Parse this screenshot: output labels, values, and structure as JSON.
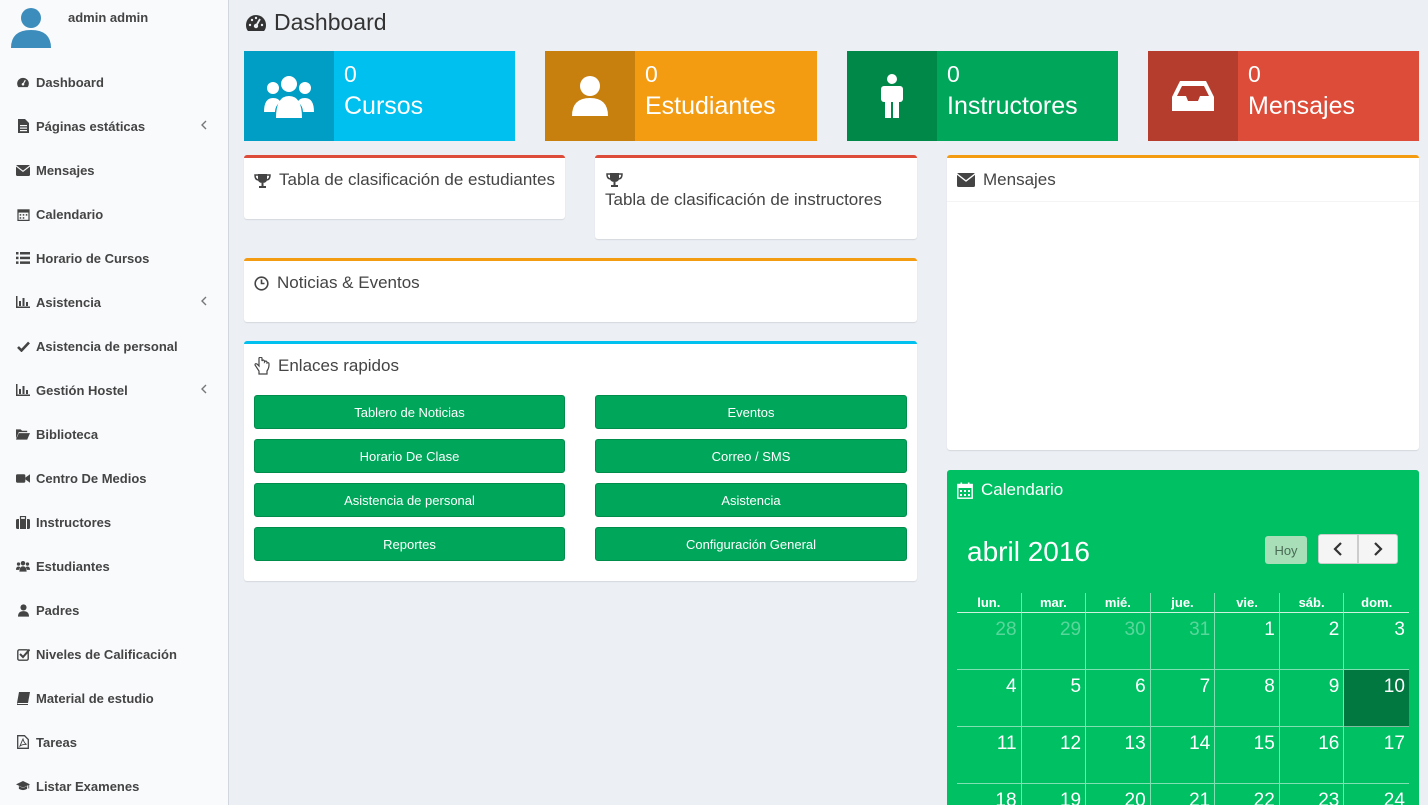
{
  "user": {
    "name": "admin admin"
  },
  "sidebar": {
    "items": [
      {
        "label": "Dashboard",
        "icon": "dashboard-icon",
        "submenu": false
      },
      {
        "label": "Páginas estáticas",
        "icon": "file-icon",
        "submenu": true
      },
      {
        "label": "Mensajes",
        "icon": "envelope-icon",
        "submenu": false
      },
      {
        "label": "Calendario",
        "icon": "calendar-icon",
        "submenu": false
      },
      {
        "label": "Horario de Cursos",
        "icon": "list-icon",
        "submenu": false
      },
      {
        "label": "Asistencia",
        "icon": "bar-chart-icon",
        "submenu": true
      },
      {
        "label": "Asistencia de personal",
        "icon": "check-icon",
        "submenu": false
      },
      {
        "label": "Gestión Hostel",
        "icon": "bar-chart-icon",
        "submenu": true
      },
      {
        "label": "Biblioteca",
        "icon": "folder-open-icon",
        "submenu": false
      },
      {
        "label": "Centro De Medios",
        "icon": "video-camera-icon",
        "submenu": false
      },
      {
        "label": "Instructores",
        "icon": "briefcase-icon",
        "submenu": false
      },
      {
        "label": "Estudiantes",
        "icon": "users-icon",
        "submenu": false
      },
      {
        "label": "Padres",
        "icon": "user-icon",
        "submenu": false
      },
      {
        "label": "Niveles de Calificación",
        "icon": "check-square-icon",
        "submenu": false
      },
      {
        "label": "Material de estudio",
        "icon": "book-icon",
        "submenu": false
      },
      {
        "label": "Tareas",
        "icon": "file-pdf-icon",
        "submenu": false
      },
      {
        "label": "Listar Examenes",
        "icon": "graduation-cap-icon",
        "submenu": false
      }
    ]
  },
  "header": {
    "title": "Dashboard"
  },
  "info_boxes": [
    {
      "number": "0",
      "label": "Cursos",
      "color": "#00c0ef",
      "icon": "users-icon"
    },
    {
      "number": "0",
      "label": "Estudiantes",
      "color": "#f39c12",
      "icon": "user-icon"
    },
    {
      "number": "0",
      "label": "Instructores",
      "color": "#00a65a",
      "icon": "male-icon"
    },
    {
      "number": "0",
      "label": "Mensajes",
      "color": "#dd4b39",
      "icon": "inbox-icon"
    }
  ],
  "boxes": {
    "students_leaderboard": "Tabla de clasificación de estudiantes",
    "instructors_leaderboard": "Tabla de clasificación de instructores",
    "news_events": "Noticias & Eventos",
    "quick_links": "Enlaces rapidos",
    "messages": "Mensajes"
  },
  "quick_links": [
    "Tablero de Noticias",
    "Eventos",
    "Horario De Clase",
    "Correo / SMS",
    "Asistencia de personal",
    "Asistencia",
    "Reportes",
    "Configuración General"
  ],
  "calendar": {
    "title": "Calendario",
    "month": "abril 2016",
    "today_button": "Hoy",
    "days_of_week": [
      "lun.",
      "mar.",
      "mié.",
      "jue.",
      "vie.",
      "sáb.",
      "dom."
    ],
    "weeks": [
      [
        {
          "d": "28",
          "other": true
        },
        {
          "d": "29",
          "other": true
        },
        {
          "d": "30",
          "other": true
        },
        {
          "d": "31",
          "other": true
        },
        {
          "d": "1"
        },
        {
          "d": "2"
        },
        {
          "d": "3"
        }
      ],
      [
        {
          "d": "4"
        },
        {
          "d": "5"
        },
        {
          "d": "6"
        },
        {
          "d": "7"
        },
        {
          "d": "8"
        },
        {
          "d": "9"
        },
        {
          "d": "10",
          "today": true
        }
      ],
      [
        {
          "d": "11"
        },
        {
          "d": "12"
        },
        {
          "d": "13"
        },
        {
          "d": "14"
        },
        {
          "d": "15"
        },
        {
          "d": "16"
        },
        {
          "d": "17"
        }
      ],
      [
        {
          "d": "18"
        },
        {
          "d": "19"
        },
        {
          "d": "20"
        },
        {
          "d": "21"
        },
        {
          "d": "22"
        },
        {
          "d": "23"
        },
        {
          "d": "24"
        }
      ]
    ]
  },
  "colors": {
    "box_border_red": "#dd4b39",
    "box_border_orange": "#f39c12",
    "box_border_blue": "#00c0ef",
    "button_green": "#00a65a",
    "calendar_green": "#00c064"
  }
}
